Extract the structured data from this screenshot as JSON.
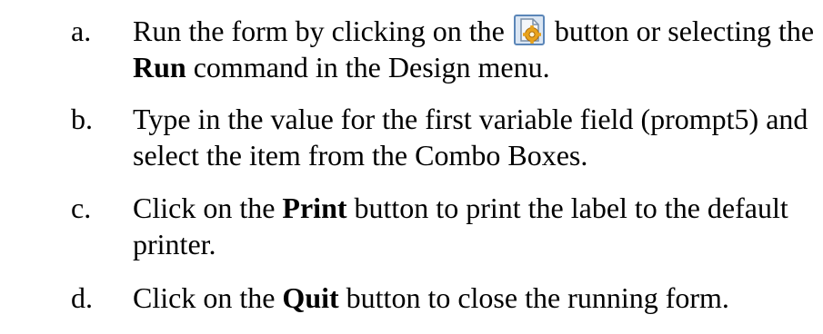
{
  "steps": [
    {
      "marker": "a.",
      "line1_pre": "Run the form by clicking on the ",
      "line1_post": " button or selecting the",
      "line2_bold": "Run",
      "line2_rest": " command in the Design menu.",
      "icon": "run-form-icon"
    },
    {
      "marker": "b.",
      "line1": "Type in the value for the first variable field (prompt5) and",
      "line2": "select the item from the Combo Boxes."
    },
    {
      "marker": "c.",
      "line1_pre": "Click on the ",
      "line1_bold": "Print",
      "line1_post": " button to print the label to the default",
      "line2": "printer."
    },
    {
      "marker": "d.",
      "line1_pre": "Click on the ",
      "line1_bold": "Quit",
      "line1_post": " button to close the running form."
    }
  ],
  "colors": {
    "text": "#000000",
    "icon_frame": "#5b86b8",
    "icon_page": "#f4f6fa",
    "icon_gear": "#e8a21c"
  }
}
